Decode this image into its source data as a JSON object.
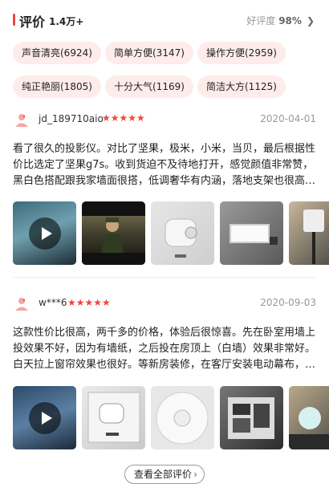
{
  "header": {
    "title": "评价",
    "count": "1.4万+",
    "rate_label": "好评度",
    "rate_value": "98%",
    "arrow": "❯"
  },
  "tags": [
    "声音清亮(6924)",
    "简单方便(3147)",
    "操作方便(2959)",
    "纯正艳丽(1805)",
    "十分大气(1169)",
    "简洁大方(1125)"
  ],
  "reviews": [
    {
      "username": "jd_189710aio",
      "stars": "★★★★★",
      "rating": 5,
      "date": "2020-04-01",
      "text": "看了很久的投影仪。对比了坚果，极米，小米，当贝，最后根据性价比选定了坚果g7s。收到货迫不及待地打开，感觉颜值非常赞，黑白色搭配跟我家墙面很搭，低调奢华有内涵，落地支架也很高…",
      "thumb_icons": [
        "video-thumbnail",
        "photo-thumbnail",
        "photo-thumbnail",
        "photo-thumbnail",
        "photo-thumbnail"
      ]
    },
    {
      "username": "w***6",
      "stars": "★★★★★",
      "rating": 5,
      "date": "2020-09-03",
      "text": "这款性价比很高，两千多的价格，体验后很惊喜。先在卧室用墙上投效果不好，因为有墙纸，之后投在房顶上（白墙）效果非常好。白天拉上窗帘效果也很好。等新房装修，在客厅安装电动幕布，…",
      "thumb_icons": [
        "video-thumbnail",
        "photo-thumbnail",
        "photo-thumbnail",
        "photo-thumbnail",
        "photo-thumbnail"
      ]
    }
  ],
  "footer": {
    "more_label": "查看全部评价",
    "more_arrow": "›"
  },
  "colors": {
    "accent": "#f0463c",
    "tag_bg": "#fdecea"
  }
}
